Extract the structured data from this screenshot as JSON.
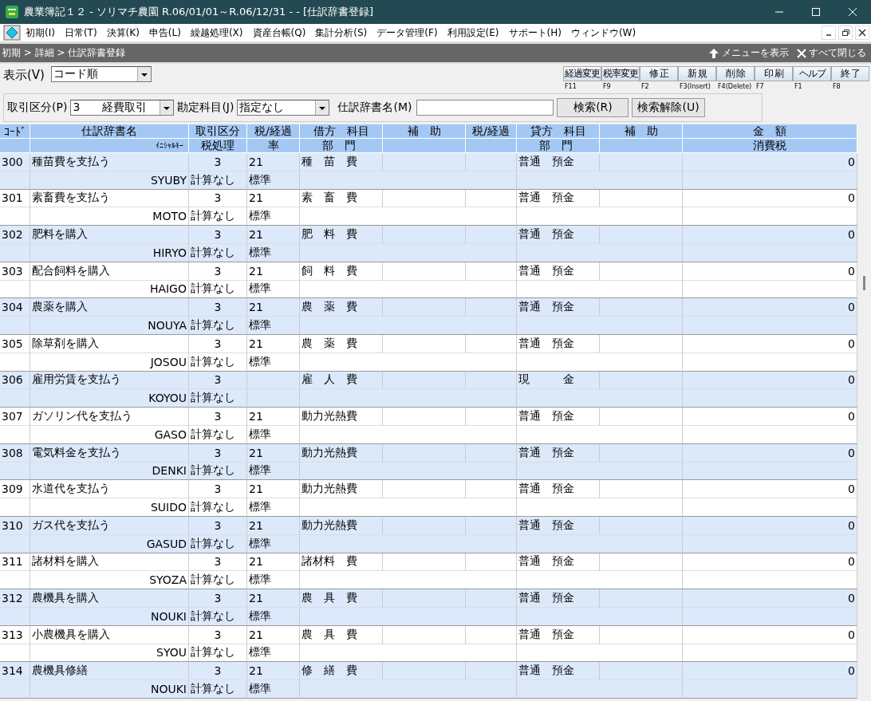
{
  "window": {
    "title": "農業簿記１２ - ソリマチ農園  R.06/01/01～R.06/12/31  - - [仕訳辞書登録]"
  },
  "menu": [
    "初期(I)",
    "日常(T)",
    "決算(K)",
    "申告(L)",
    "繰越処理(X)",
    "資産台帳(Q)",
    "集計分析(S)",
    "データ管理(F)",
    "利用設定(E)",
    "サポート(H)",
    "ウィンドウ(W)"
  ],
  "breadcrumb": "初期 > 詳細 > 仕訳辞書登録",
  "nav_actions": [
    {
      "kind": "show",
      "label": "メニューを表示"
    },
    {
      "kind": "close",
      "label": "すべて閉じる"
    }
  ],
  "view": {
    "label": "表示(V)",
    "value": "コード順"
  },
  "toolbar": [
    {
      "label": "経過変更",
      "key": "F11"
    },
    {
      "label": "税率変更",
      "key": "F9"
    },
    {
      "label": "修 正",
      "key": "F2"
    },
    {
      "label": "新 規",
      "key": "F3(Insert)"
    },
    {
      "label": "削 除",
      "key": "F4(Delete)"
    },
    {
      "label": "印 刷",
      "key": "F7"
    },
    {
      "label": "ヘルプ",
      "key": "F1"
    },
    {
      "label": "終 了",
      "key": "F8"
    }
  ],
  "filter": {
    "type_label": "取引区分(P)",
    "type_value": "3　　経費取引",
    "account_label": "勘定科目(J)",
    "account_value": "指定なし",
    "name_label": "仕訳辞書名(M)",
    "search": "検索(R)",
    "clear": "検索解除(U)"
  },
  "table": {
    "header1": [
      "ｺｰﾄﾞ",
      "仕訳辞書名",
      "取引区分",
      "税/経過",
      "借方　科目",
      "補　助",
      "税/経過",
      "貸方　科目",
      "補　助",
      "金　額"
    ],
    "header2": {
      "initial": "ｲﾆｼｬﾙｷｰ",
      "tax": "税処理",
      "rate": "率",
      "debit_dept": "部　門",
      "credit_dept": "部　門",
      "amount": "消費税"
    },
    "rows": [
      {
        "code": "300",
        "name": "種苗費を支払う",
        "kubun": "3",
        "rate": "21",
        "debit": "種　苗　費",
        "credit": "普通　預金",
        "amount": "0",
        "initial": "SYUBY",
        "tax": "計算なし",
        "rate_kind": "標準"
      },
      {
        "code": "301",
        "name": "素畜費を支払う",
        "kubun": "3",
        "rate": "21",
        "debit": "素　畜　費",
        "credit": "普通　預金",
        "amount": "0",
        "initial": "MOTO",
        "tax": "計算なし",
        "rate_kind": "標準"
      },
      {
        "code": "302",
        "name": "肥料を購入",
        "kubun": "3",
        "rate": "21",
        "debit": "肥　料　費",
        "credit": "普通　預金",
        "amount": "0",
        "initial": "HIRYO",
        "tax": "計算なし",
        "rate_kind": "標準"
      },
      {
        "code": "303",
        "name": "配合飼料を購入",
        "kubun": "3",
        "rate": "21",
        "debit": "飼　料　費",
        "credit": "普通　預金",
        "amount": "0",
        "initial": "HAIGO",
        "tax": "計算なし",
        "rate_kind": "標準"
      },
      {
        "code": "304",
        "name": "農薬を購入",
        "kubun": "3",
        "rate": "21",
        "debit": "農　薬　費",
        "credit": "普通　預金",
        "amount": "0",
        "initial": "NOUYA",
        "tax": "計算なし",
        "rate_kind": "標準"
      },
      {
        "code": "305",
        "name": "除草剤を購入",
        "kubun": "3",
        "rate": "21",
        "debit": "農　薬　費",
        "credit": "普通　預金",
        "amount": "0",
        "initial": "JOSOU",
        "tax": "計算なし",
        "rate_kind": "標準"
      },
      {
        "code": "306",
        "name": "雇用労賃を支払う",
        "kubun": "3",
        "debit": "雇　人　費",
        "credit": "現　　　金",
        "amount": "0",
        "initial": "KOYOU",
        "tax": "計算なし"
      },
      {
        "code": "307",
        "name": "ガソリン代を支払う",
        "kubun": "3",
        "rate": "21",
        "debit": "動力光熱費",
        "credit": "普通　預金",
        "amount": "0",
        "initial": "GASO",
        "tax": "計算なし",
        "rate_kind": "標準"
      },
      {
        "code": "308",
        "name": "電気料金を支払う",
        "kubun": "3",
        "rate": "21",
        "debit": "動力光熱費",
        "credit": "普通　預金",
        "amount": "0",
        "initial": "DENKI",
        "tax": "計算なし",
        "rate_kind": "標準"
      },
      {
        "code": "309",
        "name": "水道代を支払う",
        "kubun": "3",
        "rate": "21",
        "debit": "動力光熱費",
        "credit": "普通　預金",
        "amount": "0",
        "initial": "SUIDO",
        "tax": "計算なし",
        "rate_kind": "標準"
      },
      {
        "code": "310",
        "name": "ガス代を支払う",
        "kubun": "3",
        "rate": "21",
        "debit": "動力光熱費",
        "credit": "普通　預金",
        "amount": "0",
        "initial": "GASUD",
        "tax": "計算なし",
        "rate_kind": "標準"
      },
      {
        "code": "311",
        "name": "諸材料を購入",
        "kubun": "3",
        "rate": "21",
        "debit": "諸材料　費",
        "credit": "普通　預金",
        "amount": "0",
        "initial": "SYOZA",
        "tax": "計算なし",
        "rate_kind": "標準"
      },
      {
        "code": "312",
        "name": "農機具を購入",
        "kubun": "3",
        "rate": "21",
        "debit": "農　具　費",
        "credit": "普通　預金",
        "amount": "0",
        "initial": "NOUKI",
        "tax": "計算なし",
        "rate_kind": "標準"
      },
      {
        "code": "313",
        "name": "小農機具を購入",
        "kubun": "3",
        "rate": "21",
        "debit": "農　具　費",
        "credit": "普通　預金",
        "amount": "0",
        "initial": "SYOU",
        "tax": "計算なし",
        "rate_kind": "標準"
      },
      {
        "code": "314",
        "name": "農機具修繕",
        "kubun": "3",
        "rate": "21",
        "debit": "修　繕　費",
        "credit": "普通　預金",
        "amount": "0",
        "initial": "NOUKI",
        "tax": "計算なし",
        "rate_kind": "標準"
      }
    ]
  }
}
